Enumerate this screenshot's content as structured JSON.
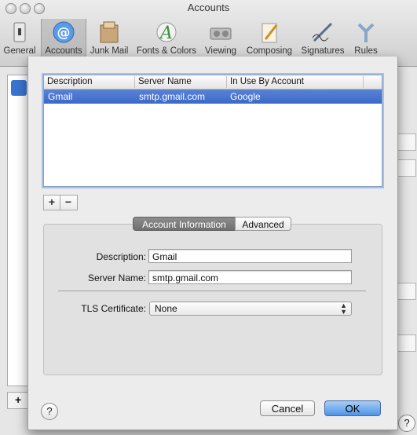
{
  "window": {
    "title": "Accounts"
  },
  "toolbar": {
    "items": [
      {
        "label": "General",
        "icon": "general-switch-icon"
      },
      {
        "label": "Accounts",
        "icon": "at-sign-icon",
        "selected": true
      },
      {
        "label": "Junk Mail",
        "icon": "junk-mail-icon"
      },
      {
        "label": "Fonts & Colors",
        "icon": "fonts-colors-icon"
      },
      {
        "label": "Viewing",
        "icon": "viewing-icon"
      },
      {
        "label": "Composing",
        "icon": "composing-icon"
      },
      {
        "label": "Signatures",
        "icon": "signatures-icon"
      },
      {
        "label": "Rules",
        "icon": "rules-icon"
      }
    ]
  },
  "smtp_sheet": {
    "table": {
      "columns": [
        "Description",
        "Server Name",
        "In Use By Account"
      ],
      "rows": [
        {
          "description": "Gmail",
          "server_name": "smtp.gmail.com",
          "in_use_by": "Google",
          "selected": true
        }
      ]
    },
    "add_label": "+",
    "remove_label": "−",
    "tabs": [
      "Account Information",
      "Advanced"
    ],
    "active_tab": "Account Information",
    "form": {
      "description_label": "Description:",
      "description_value": "Gmail",
      "server_name_label": "Server Name:",
      "server_name_value": "smtp.gmail.com",
      "tls_label": "TLS Certificate:",
      "tls_value": "None"
    },
    "help_label": "?",
    "cancel_label": "Cancel",
    "ok_label": "OK"
  },
  "background": {
    "help_label": "?",
    "add_label": "+"
  },
  "colors": {
    "selection": "#3a69cb",
    "ok_button": "#4f93e6",
    "segment_active": "#707070"
  }
}
